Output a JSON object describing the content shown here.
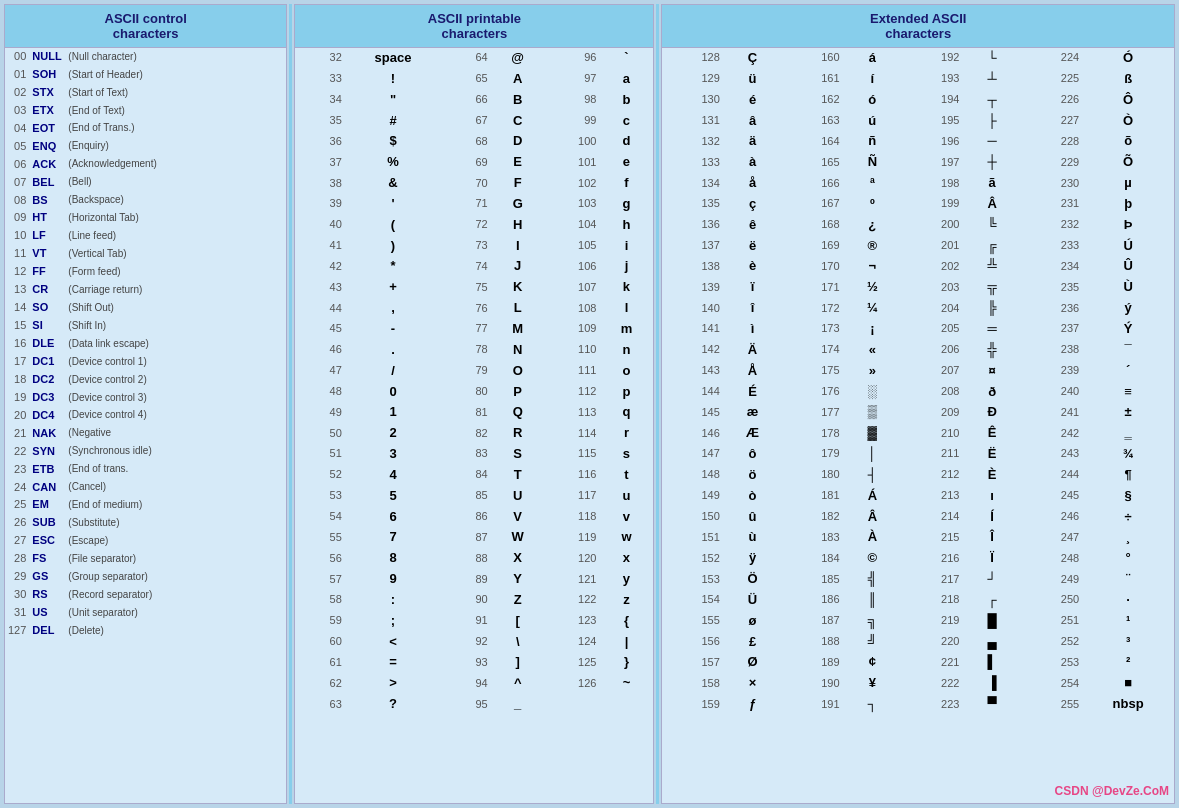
{
  "sections": [
    {
      "title": "ASCII control\ncharacters",
      "rows": [
        {
          "num": "00",
          "abbr": "NULL",
          "desc": "(Null character)"
        },
        {
          "num": "01",
          "abbr": "SOH",
          "desc": "(Start of Header)"
        },
        {
          "num": "02",
          "abbr": "STX",
          "desc": "(Start of Text)"
        },
        {
          "num": "03",
          "abbr": "ETX",
          "desc": "(End of Text)"
        },
        {
          "num": "04",
          "abbr": "EOT",
          "desc": "(End of Trans.)"
        },
        {
          "num": "05",
          "abbr": "ENQ",
          "desc": "(Enquiry)"
        },
        {
          "num": "06",
          "abbr": "ACK",
          "desc": "(Acknowledgement)"
        },
        {
          "num": "07",
          "abbr": "BEL",
          "desc": "(Bell)"
        },
        {
          "num": "08",
          "abbr": "BS",
          "desc": "(Backspace)"
        },
        {
          "num": "09",
          "abbr": "HT",
          "desc": "(Horizontal Tab)"
        },
        {
          "num": "10",
          "abbr": "LF",
          "desc": "(Line feed)"
        },
        {
          "num": "11",
          "abbr": "VT",
          "desc": "(Vertical Tab)"
        },
        {
          "num": "12",
          "abbr": "FF",
          "desc": "(Form feed)"
        },
        {
          "num": "13",
          "abbr": "CR",
          "desc": "(Carriage return)"
        },
        {
          "num": "14",
          "abbr": "SO",
          "desc": "(Shift Out)"
        },
        {
          "num": "15",
          "abbr": "SI",
          "desc": "(Shift In)"
        },
        {
          "num": "16",
          "abbr": "DLE",
          "desc": "(Data link escape)"
        },
        {
          "num": "17",
          "abbr": "DC1",
          "desc": "(Device control 1)"
        },
        {
          "num": "18",
          "abbr": "DC2",
          "desc": "(Device control 2)"
        },
        {
          "num": "19",
          "abbr": "DC3",
          "desc": "(Device control 3)"
        },
        {
          "num": "20",
          "abbr": "DC4",
          "desc": "(Device control 4)"
        },
        {
          "num": "21",
          "abbr": "NAK",
          "desc": "(Negative"
        },
        {
          "num": "22",
          "abbr": "SYN",
          "desc": "(Synchronous idle)"
        },
        {
          "num": "23",
          "abbr": "ETB",
          "desc": "(End of trans."
        },
        {
          "num": "24",
          "abbr": "CAN",
          "desc": "(Cancel)"
        },
        {
          "num": "25",
          "abbr": "EM",
          "desc": "(End of medium)"
        },
        {
          "num": "26",
          "abbr": "SUB",
          "desc": "(Substitute)"
        },
        {
          "num": "27",
          "abbr": "ESC",
          "desc": "(Escape)"
        },
        {
          "num": "28",
          "abbr": "FS",
          "desc": "(File separator)"
        },
        {
          "num": "29",
          "abbr": "GS",
          "desc": "(Group separator)"
        },
        {
          "num": "30",
          "abbr": "RS",
          "desc": "(Record separator)"
        },
        {
          "num": "31",
          "abbr": "US",
          "desc": "(Unit separator)"
        },
        {
          "num": "127",
          "abbr": "DEL",
          "desc": "(Delete)"
        }
      ]
    },
    {
      "title": "ASCII printable\ncharacters",
      "rows": [
        {
          "num": "32",
          "char": "space",
          "num2": "64",
          "char2": "@",
          "num3": "96",
          "char3": "`"
        },
        {
          "num": "33",
          "char": "!",
          "num2": "65",
          "char2": "A",
          "num3": "97",
          "char3": "a"
        },
        {
          "num": "34",
          "char": "\"",
          "num2": "66",
          "char2": "B",
          "num3": "98",
          "char3": "b"
        },
        {
          "num": "35",
          "char": "#",
          "num2": "67",
          "char2": "C",
          "num3": "99",
          "char3": "c"
        },
        {
          "num": "36",
          "char": "$",
          "num2": "68",
          "char2": "D",
          "num3": "100",
          "char3": "d"
        },
        {
          "num": "37",
          "char": "%",
          "num2": "69",
          "char2": "E",
          "num3": "101",
          "char3": "e"
        },
        {
          "num": "38",
          "char": "&",
          "num2": "70",
          "char2": "F",
          "num3": "102",
          "char3": "f"
        },
        {
          "num": "39",
          "char": "'",
          "num2": "71",
          "char2": "G",
          "num3": "103",
          "char3": "g"
        },
        {
          "num": "40",
          "char": "(",
          "num2": "72",
          "char2": "H",
          "num3": "104",
          "char3": "h"
        },
        {
          "num": "41",
          "char": ")",
          "num2": "73",
          "char2": "I",
          "num3": "105",
          "char3": "i"
        },
        {
          "num": "42",
          "char": "*",
          "num2": "74",
          "char2": "J",
          "num3": "106",
          "char3": "j"
        },
        {
          "num": "43",
          "char": "+",
          "num2": "75",
          "char2": "K",
          "num3": "107",
          "char3": "k"
        },
        {
          "num": "44",
          "char": ",",
          "num2": "76",
          "char2": "L",
          "num3": "108",
          "char3": "l"
        },
        {
          "num": "45",
          "char": "-",
          "num2": "77",
          "char2": "M",
          "num3": "109",
          "char3": "m"
        },
        {
          "num": "46",
          "char": ".",
          "num2": "78",
          "char2": "N",
          "num3": "110",
          "char3": "n"
        },
        {
          "num": "47",
          "char": "/",
          "num2": "79",
          "char2": "O",
          "num3": "111",
          "char3": "o"
        },
        {
          "num": "48",
          "char": "0",
          "num2": "80",
          "char2": "P",
          "num3": "112",
          "char3": "p"
        },
        {
          "num": "49",
          "char": "1",
          "num2": "81",
          "char2": "Q",
          "num3": "113",
          "char3": "q"
        },
        {
          "num": "50",
          "char": "2",
          "num2": "82",
          "char2": "R",
          "num3": "114",
          "char3": "r"
        },
        {
          "num": "51",
          "char": "3",
          "num2": "83",
          "char2": "S",
          "num3": "115",
          "char3": "s"
        },
        {
          "num": "52",
          "char": "4",
          "num2": "84",
          "char2": "T",
          "num3": "116",
          "char3": "t"
        },
        {
          "num": "53",
          "char": "5",
          "num2": "85",
          "char2": "U",
          "num3": "117",
          "char3": "u"
        },
        {
          "num": "54",
          "char": "6",
          "num2": "86",
          "char2": "V",
          "num3": "118",
          "char3": "v"
        },
        {
          "num": "55",
          "char": "7",
          "num2": "87",
          "char2": "W",
          "num3": "119",
          "char3": "w"
        },
        {
          "num": "56",
          "char": "8",
          "num2": "88",
          "char2": "X",
          "num3": "120",
          "char3": "x"
        },
        {
          "num": "57",
          "char": "9",
          "num2": "89",
          "char2": "Y",
          "num3": "121",
          "char3": "y"
        },
        {
          "num": "58",
          "char": ":",
          "num2": "90",
          "char2": "Z",
          "num3": "122",
          "char3": "z"
        },
        {
          "num": "59",
          "char": ";",
          "num2": "91",
          "char2": "[",
          "num3": "123",
          "char3": "{"
        },
        {
          "num": "60",
          "char": "<",
          "num2": "92",
          "char2": "\\",
          "num3": "124",
          "char3": "|"
        },
        {
          "num": "61",
          "char": "=",
          "num2": "93",
          "char2": "]",
          "num3": "125",
          "char3": "}"
        },
        {
          "num": "62",
          "char": ">",
          "num2": "94",
          "char2": "^",
          "num3": "126",
          "char3": "~"
        },
        {
          "num": "63",
          "char": "?",
          "num2": "95",
          "char2": "_",
          "num3": "",
          "char3": ""
        }
      ]
    },
    {
      "title": "Extended ASCII\ncharacters",
      "rows": [
        {
          "n1": "128",
          "c1": "Ç",
          "n2": "160",
          "c2": "á",
          "n3": "192",
          "c3": "└",
          "n4": "224",
          "c4": "Ó"
        },
        {
          "n1": "129",
          "c1": "ü",
          "n2": "161",
          "c2": "í",
          "n3": "193",
          "c3": "┴",
          "n4": "225",
          "c4": "ß"
        },
        {
          "n1": "130",
          "c1": "é",
          "n2": "162",
          "c2": "ó",
          "n3": "194",
          "c3": "┬",
          "n4": "226",
          "c4": "Ô"
        },
        {
          "n1": "131",
          "c1": "â",
          "n2": "163",
          "c2": "ú",
          "n3": "195",
          "c3": "├",
          "n4": "227",
          "c4": "Ò"
        },
        {
          "n1": "132",
          "c1": "ä",
          "n2": "164",
          "c2": "ñ",
          "n3": "196",
          "c3": "─",
          "n4": "228",
          "c4": "õ"
        },
        {
          "n1": "133",
          "c1": "à",
          "n2": "165",
          "c2": "Ñ",
          "n3": "197",
          "c3": "┼",
          "n4": "229",
          "c4": "Õ"
        },
        {
          "n1": "134",
          "c1": "å",
          "n2": "166",
          "c2": "ª",
          "n3": "198",
          "c3": "ã",
          "n4": "230",
          "c4": "µ"
        },
        {
          "n1": "135",
          "c1": "ç",
          "n2": "167",
          "c2": "º",
          "n3": "199",
          "c3": "Â",
          "n4": "231",
          "c4": "þ"
        },
        {
          "n1": "136",
          "c1": "ê",
          "n2": "168",
          "c2": "¿",
          "n3": "200",
          "c3": "╚",
          "n4": "232",
          "c4": "Þ"
        },
        {
          "n1": "137",
          "c1": "ë",
          "n2": "169",
          "c2": "®",
          "n3": "201",
          "c3": "╔",
          "n4": "233",
          "c4": "Ú"
        },
        {
          "n1": "138",
          "c1": "è",
          "n2": "170",
          "c2": "¬",
          "n3": "202",
          "c3": "╩",
          "n4": "234",
          "c4": "Û"
        },
        {
          "n1": "139",
          "c1": "ï",
          "n2": "171",
          "c2": "½",
          "n3": "203",
          "c3": "╦",
          "n4": "235",
          "c4": "Ù"
        },
        {
          "n1": "140",
          "c1": "î",
          "n2": "172",
          "c2": "¼",
          "n3": "204",
          "c3": "╠",
          "n4": "236",
          "c4": "ý"
        },
        {
          "n1": "141",
          "c1": "ì",
          "n2": "173",
          "c2": "¡",
          "n3": "205",
          "c3": "═",
          "n4": "237",
          "c4": "Ý"
        },
        {
          "n1": "142",
          "c1": "Ä",
          "n2": "174",
          "c2": "«",
          "n3": "206",
          "c3": "╬",
          "n4": "238",
          "c4": "¯"
        },
        {
          "n1": "143",
          "c1": "Å",
          "n2": "175",
          "c2": "»",
          "n3": "207",
          "c3": "¤",
          "n4": "239",
          "c4": "´"
        },
        {
          "n1": "144",
          "c1": "É",
          "n2": "176",
          "c2": "░",
          "n3": "208",
          "c3": "ð",
          "n4": "240",
          "c4": "≡"
        },
        {
          "n1": "145",
          "c1": "æ",
          "n2": "177",
          "c2": "▒",
          "n3": "209",
          "c3": "Ð",
          "n4": "241",
          "c4": "±"
        },
        {
          "n1": "146",
          "c1": "Æ",
          "n2": "178",
          "c2": "▓",
          "n3": "210",
          "c3": "Ê",
          "n4": "242",
          "c4": "‗"
        },
        {
          "n1": "147",
          "c1": "ô",
          "n2": "179",
          "c2": "│",
          "n3": "211",
          "c3": "Ë",
          "n4": "243",
          "c4": "¾"
        },
        {
          "n1": "148",
          "c1": "ö",
          "n2": "180",
          "c2": "┤",
          "n3": "212",
          "c3": "È",
          "n4": "244",
          "c4": "¶"
        },
        {
          "n1": "149",
          "c1": "ò",
          "n2": "181",
          "c2": "Á",
          "n3": "213",
          "c3": "ı",
          "n4": "245",
          "c4": "§"
        },
        {
          "n1": "150",
          "c1": "û",
          "n2": "182",
          "c2": "Â",
          "n3": "214",
          "c3": "Í",
          "n4": "246",
          "c4": "÷"
        },
        {
          "n1": "151",
          "c1": "ù",
          "n2": "183",
          "c2": "À",
          "n3": "215",
          "c3": "Î",
          "n4": "247",
          "c4": "¸"
        },
        {
          "n1": "152",
          "c1": "ÿ",
          "n2": "184",
          "c2": "©",
          "n3": "216",
          "c3": "Ï",
          "n4": "248",
          "c4": "°"
        },
        {
          "n1": "153",
          "c1": "Ö",
          "n2": "185",
          "c2": "╣",
          "n3": "217",
          "c3": "┘",
          "n4": "249",
          "c4": "¨"
        },
        {
          "n1": "154",
          "c1": "Ü",
          "n2": "186",
          "c2": "║",
          "n3": "218",
          "c3": "┌",
          "n4": "250",
          "c4": "·"
        },
        {
          "n1": "155",
          "c1": "ø",
          "n2": "187",
          "c2": "╗",
          "n3": "219",
          "c3": "█",
          "n4": "251",
          "c4": "¹"
        },
        {
          "n1": "156",
          "c1": "£",
          "n2": "188",
          "c2": "╝",
          "n3": "220",
          "c3": "▄",
          "n4": "252",
          "c4": "³"
        },
        {
          "n1": "157",
          "c1": "Ø",
          "n2": "189",
          "c2": "¢",
          "n3": "221",
          "c3": "▌",
          "n4": "253",
          "c4": "²"
        },
        {
          "n1": "158",
          "c1": "×",
          "n2": "190",
          "c2": "¥",
          "n3": "222",
          "c3": "▐",
          "n4": "254",
          "c4": "■"
        },
        {
          "n1": "159",
          "c1": "ƒ",
          "n2": "191",
          "c2": "┐",
          "n3": "223",
          "c3": "▀",
          "n4": "255",
          "c4": "nbsp"
        }
      ]
    }
  ]
}
